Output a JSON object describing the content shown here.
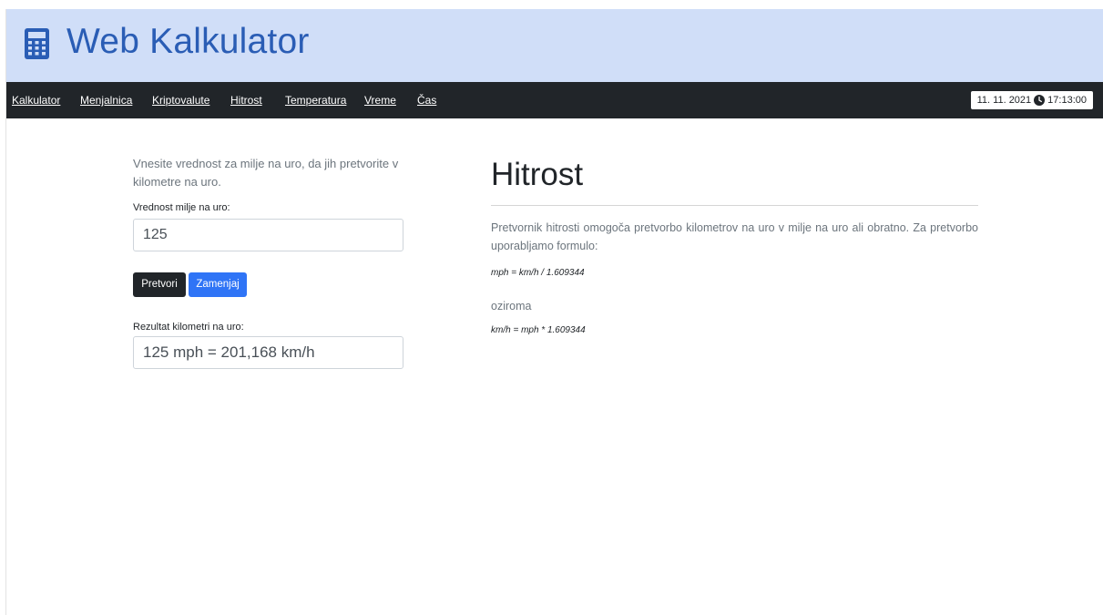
{
  "header": {
    "icon": "calculator-icon",
    "title": "Web Kalkulator",
    "background": "#d0def8",
    "accent": "#2a5db5"
  },
  "nav": {
    "items": [
      {
        "label": "Kalkulator"
      },
      {
        "label": "Menjalnica"
      },
      {
        "label": "Kriptovalute"
      },
      {
        "label": "Hitrost"
      },
      {
        "label": "Temperatura"
      },
      {
        "label": "Vreme"
      },
      {
        "label": "Čas"
      }
    ],
    "date": "11. 11. 2021",
    "time": "17:13:00",
    "clock_icon": "clock-icon"
  },
  "form": {
    "intro": "Vnesite vrednost za milje na uro, da jih pretvorite v kilometre na uro.",
    "input_label": "Vrednost milje na uro:",
    "input_value": "125",
    "convert_button": "Pretvori",
    "swap_button": "Zamenjaj",
    "result_label": "Rezultat kilometri na uro:",
    "result_value": "125 mph = 201,168 km/h"
  },
  "info": {
    "title": "Hitrost",
    "description": "Pretvornik hitrosti omogoča pretvorbo kilometrov na uro v milje na uro ali obratno. Za pretvorbo uporabljamo formulo:",
    "formula1": "mph = km/h / 1.609344",
    "or_text": "oziroma",
    "formula2": "km/h = mph * 1.609344"
  }
}
